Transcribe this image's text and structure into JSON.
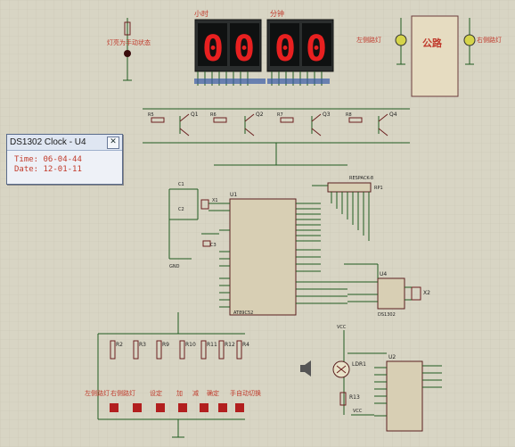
{
  "display_labels": {
    "hour": "小时",
    "minute": "分钟"
  },
  "digits": [
    "0",
    "0",
    "0",
    "0"
  ],
  "road_label": "公路",
  "lamp_labels": {
    "left": "左侧路灯",
    "right": "右侧路灯"
  },
  "status_led_label": "灯亮为手动状态",
  "window": {
    "title": "DS1302 Clock - U4",
    "time_label": "Time:",
    "time_value": "06-04-44",
    "date_label": "Date:",
    "date_value": "12-01-11"
  },
  "chips": {
    "mcu_ref": "U1",
    "mcu_type": "AT89C52",
    "rtc_ref": "U4",
    "rtc_type": "DS1302",
    "rp_ref": "RP1",
    "rp_type": "RESPACK-8",
    "u2_ref": "U2",
    "crystal_rtc": "X2"
  },
  "transistors": [
    "Q1",
    "Q2",
    "Q3",
    "Q4"
  ],
  "resistors_top": [
    "R5",
    "R6",
    "R7",
    "R8"
  ],
  "button_resistors": [
    "R2",
    "R3",
    "R9",
    "R10",
    "R11",
    "R12",
    "R4"
  ],
  "button_labels": [
    "左侧路灯",
    "右侧路灯",
    "设定",
    "加",
    "减",
    "确定",
    "手自动切换"
  ],
  "ldr_label": "LDR1",
  "r13_label": "R13",
  "vcc_label": "VCC",
  "caps": [
    "C1",
    "C2",
    "C3"
  ],
  "crystal_mcu": "X1"
}
